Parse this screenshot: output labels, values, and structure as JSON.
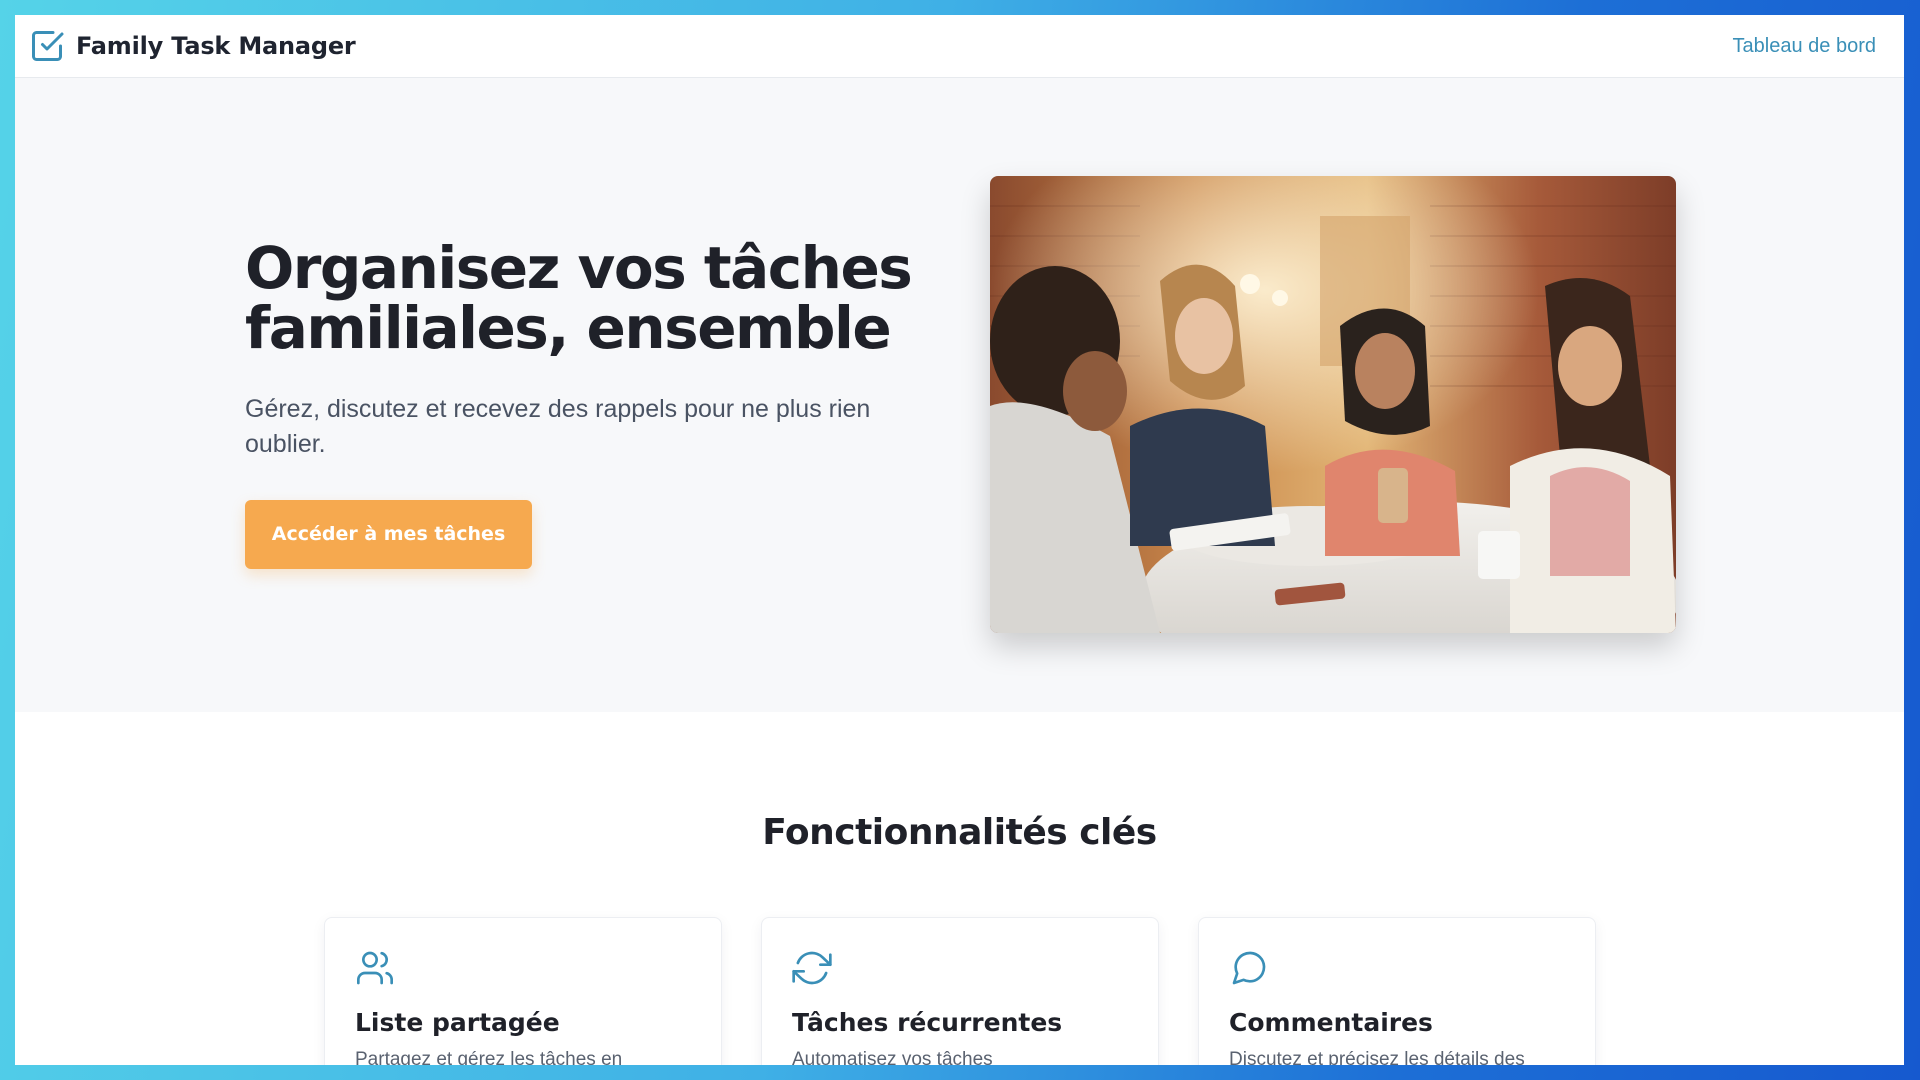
{
  "app": {
    "title": "Family Task Manager"
  },
  "header": {
    "nav_link_label": "Tableau de bord"
  },
  "hero": {
    "title_line1": "Organisez vos tâches",
    "title_line2": "familiales, ensemble",
    "subtitle": "Gérez, discutez et recevez des rappels pour ne plus rien oublier.",
    "cta_label": "Accéder à mes tâches"
  },
  "features": {
    "heading": "Fonctionnalités clés",
    "items": [
      {
        "icon": "users-icon",
        "title": "Liste partagée",
        "description": "Partagez et gérez les tâches en"
      },
      {
        "icon": "refresh-icon",
        "title": "Tâches récurrentes",
        "description": "Automatisez vos tâches"
      },
      {
        "icon": "chat-bubble-icon",
        "title": "Commentaires",
        "description": "Discutez et précisez les détails des"
      }
    ]
  },
  "colors": {
    "accent": "#f6a94f",
    "link": "#3a8fb7",
    "icon": "#3a8fb7",
    "heading": "#1f2129",
    "hero_background": "#f7f8fa"
  }
}
